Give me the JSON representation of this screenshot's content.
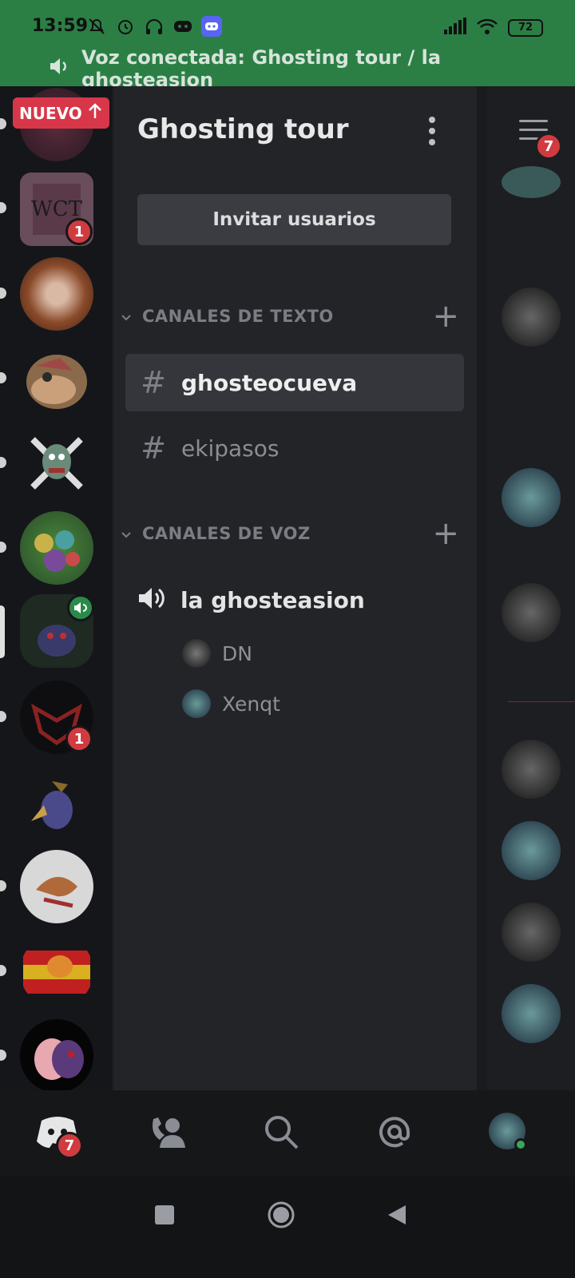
{
  "status_bar": {
    "time": "13:59",
    "battery": "72",
    "voice_banner": "Voz conectada: Ghosting tour / la ghosteasion"
  },
  "rail": {
    "new_pill_label": "NUEVO",
    "badges": [
      "1",
      "1"
    ]
  },
  "panel": {
    "server_title": "Ghosting tour",
    "invite_button": "Invitar usuarios",
    "text_category": "CANALES DE TEXTO",
    "voice_category": "CANALES DE VOZ",
    "text_channels": [
      {
        "name": "ghosteocueva",
        "selected": true
      },
      {
        "name": "ekipasos",
        "selected": false
      }
    ],
    "voice_channel": {
      "name": "la ghosteasion",
      "members": [
        "DN",
        "Xenqt"
      ]
    }
  },
  "chat": {
    "menu_badge": "7"
  },
  "bottom_nav": {
    "home_badge": "7"
  },
  "colors": {
    "status_green": "#2b7f45",
    "badge_red": "#d03b3f",
    "panel_bg": "#232428"
  }
}
